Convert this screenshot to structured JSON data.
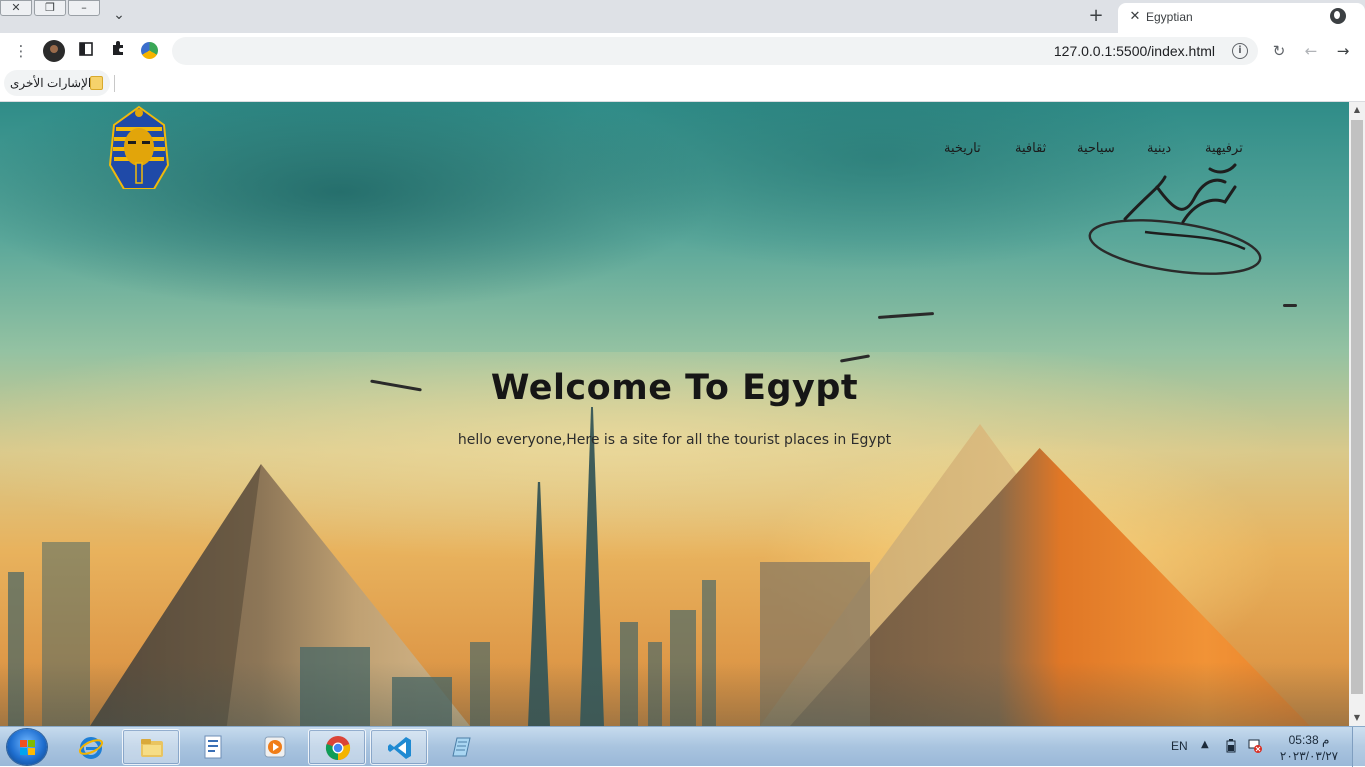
{
  "browser": {
    "tab": {
      "title": "Egyptian"
    },
    "omnibox": {
      "url": "127.0.0.1:5500/index.html"
    },
    "bookmarks": {
      "folder_label": "الإشارات الأخرى"
    }
  },
  "site": {
    "nav": [
      {
        "label": "ترفيهية"
      },
      {
        "label": "دينية"
      },
      {
        "label": "سياحية"
      },
      {
        "label": "ثقافية"
      },
      {
        "label": "تاريخية"
      }
    ],
    "hero": {
      "title": "Welcome To Egypt",
      "subtitle": "hello everyone,Here is a site for all the tourist places in Egypt"
    }
  },
  "taskbar": {
    "language": "EN",
    "clock_time": "05:38 م",
    "clock_date": "٢٠٢٣/٠٣/٢٧",
    "apps": [
      {
        "name": "internet-explorer"
      },
      {
        "name": "file-explorer"
      },
      {
        "name": "document-app"
      },
      {
        "name": "media-player"
      },
      {
        "name": "chrome"
      },
      {
        "name": "vscode"
      },
      {
        "name": "notepad"
      }
    ]
  },
  "colors": {
    "sky_top": "#2f8c88",
    "sky_bottom": "#d88a3c",
    "pyramid_orange": "#f19336",
    "taskbar": "#a9c4df"
  }
}
